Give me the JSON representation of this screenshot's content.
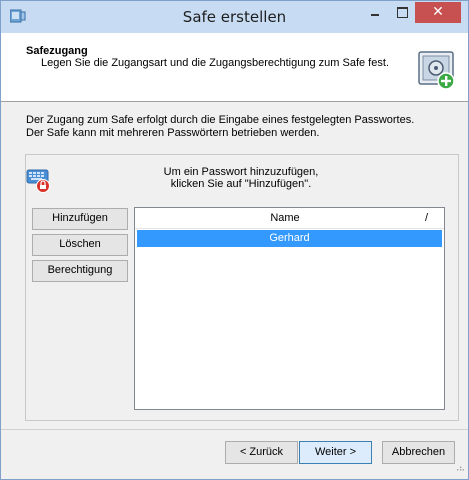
{
  "window": {
    "title": "Safe erstellen",
    "close_symbol": "✕",
    "accent_color": "#3399ff",
    "close_color": "#c75050"
  },
  "header": {
    "title": "Safezugang",
    "subtitle": "Legen Sie die Zugangsart und die Zugangsberechtigung zum Safe fest.",
    "icon": "safe-add-icon"
  },
  "description": {
    "line1": "Der Zugang zum Safe erfolgt durch die Eingabe eines festgelegten Passwortes.",
    "line2": "Der Safe kann mit mehreren Passwörtern betrieben werden."
  },
  "passwords": {
    "icon": "keyboard-lock-icon",
    "hint_line1": "Um ein Passwort hinzuzufügen,",
    "hint_line2": "klicken Sie auf \"Hinzufügen\".",
    "buttons": {
      "add": "Hinzufügen",
      "delete": "Löschen",
      "permission": "Berechtigung"
    },
    "list": {
      "column": "Name",
      "sort_indicator": "/",
      "rows": [
        "Gerhard"
      ],
      "selected_index": 0
    }
  },
  "footer": {
    "back": "< Zurück",
    "next": "Weiter >",
    "cancel": "Abbrechen"
  }
}
